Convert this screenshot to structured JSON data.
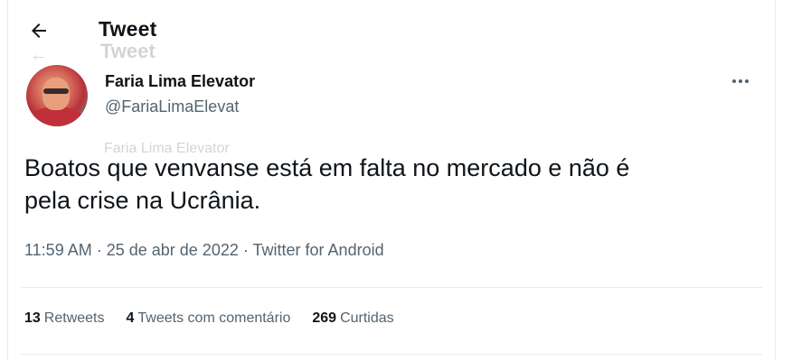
{
  "header": {
    "title": "Tweet",
    "back_icon": "arrow-left-icon"
  },
  "ghost": {
    "back": "←",
    "title": "Tweet",
    "name": "Faria Lima Elevator"
  },
  "tweet": {
    "author": {
      "display_name": "Faria Lima Elevator",
      "handle": "@FariaLimaElevat",
      "avatar_icon": "user-avatar"
    },
    "more_icon": "more-options-icon",
    "text_line1": "Boatos que venvanse está em falta no mercado e não é",
    "text_line2": "pela crise na Ucrânia.",
    "time": "11:59 AM",
    "sep1": " · ",
    "date": "25 de abr de 2022",
    "sep2": " · ",
    "source": "Twitter for Android"
  },
  "stats": {
    "retweets_count": "13",
    "retweets_label": "Retweets",
    "quotes_count": "4",
    "quotes_label": "Tweets com comentário",
    "likes_count": "269",
    "likes_label": "Curtidas"
  },
  "colors": {
    "text_primary": "#0f1419",
    "text_secondary": "#536471",
    "border": "#e6ecf0"
  }
}
